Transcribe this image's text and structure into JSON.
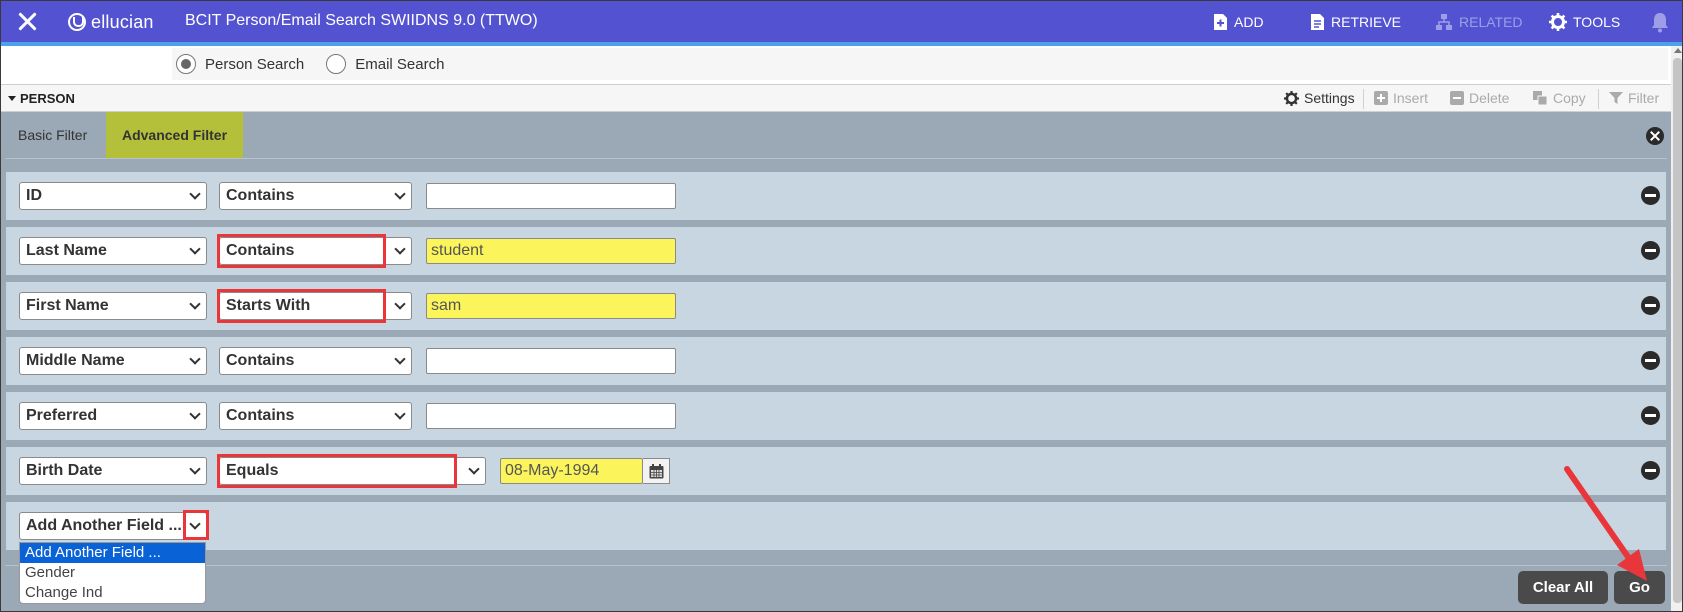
{
  "header": {
    "brand": "ellucian",
    "title": "BCIT Person/Email Search SWIIDNS 9.0 (TTWO)",
    "add_label": "ADD",
    "retrieve_label": "RETRIEVE",
    "related_label": "RELATED",
    "tools_label": "TOOLS"
  },
  "search_type": {
    "person_label": "Person Search",
    "email_label": "Email Search",
    "selected": "person"
  },
  "section": {
    "title": "PERSON",
    "settings_label": "Settings",
    "insert_label": "Insert",
    "delete_label": "Delete",
    "copy_label": "Copy",
    "filter_label": "Filter"
  },
  "tabs": {
    "basic": "Basic Filter",
    "advanced": "Advanced Filter"
  },
  "rows": [
    {
      "field": "ID",
      "operator": "Contains",
      "value": ""
    },
    {
      "field": "Last Name",
      "operator": "Contains",
      "value": "student"
    },
    {
      "field": "First Name",
      "operator": "Starts With",
      "value": "sam"
    },
    {
      "field": "Middle Name",
      "operator": "Contains",
      "value": ""
    },
    {
      "field": "Preferred",
      "operator": "Contains",
      "value": ""
    },
    {
      "field": "Birth Date",
      "operator": "Equals",
      "value": "08-May-1994"
    }
  ],
  "add_field": {
    "label": "Add Another Field ...",
    "options": [
      "Add Another Field ...",
      "Gender",
      "Change Ind"
    ]
  },
  "buttons": {
    "clear_all": "Clear All",
    "go": "Go"
  },
  "colors": {
    "header_bg": "#5353d1",
    "active_tab": "#b5c03a",
    "filled_input": "#fbf45b",
    "highlight_box": "#e8363a"
  }
}
